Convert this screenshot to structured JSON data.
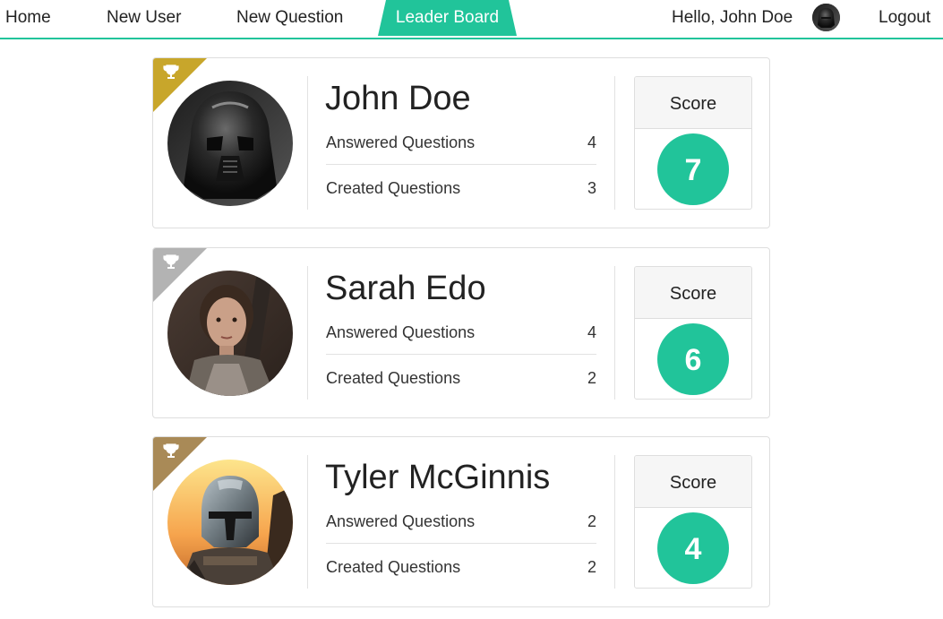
{
  "nav": {
    "items": [
      "Home",
      "New User",
      "New Question",
      "Leader Board"
    ],
    "active": "Leader Board",
    "greeting": "Hello, John Doe",
    "logout": "Logout",
    "accent": "#21c49a"
  },
  "leaderboard": [
    {
      "name": "John Doe",
      "answered_label": "Answered Questions",
      "answered": "4",
      "created_label": "Created Questions",
      "created": "3",
      "score_label": "Score",
      "score": "7",
      "rank_color": "#c8a62b"
    },
    {
      "name": "Sarah Edo",
      "answered_label": "Answered Questions",
      "answered": "4",
      "created_label": "Created Questions",
      "created": "2",
      "score_label": "Score",
      "score": "6",
      "rank_color": "#b3b3b3"
    },
    {
      "name": "Tyler McGinnis",
      "answered_label": "Answered Questions",
      "answered": "2",
      "created_label": "Created Questions",
      "created": "2",
      "score_label": "Score",
      "score": "4",
      "rank_color": "#a98a57"
    }
  ]
}
